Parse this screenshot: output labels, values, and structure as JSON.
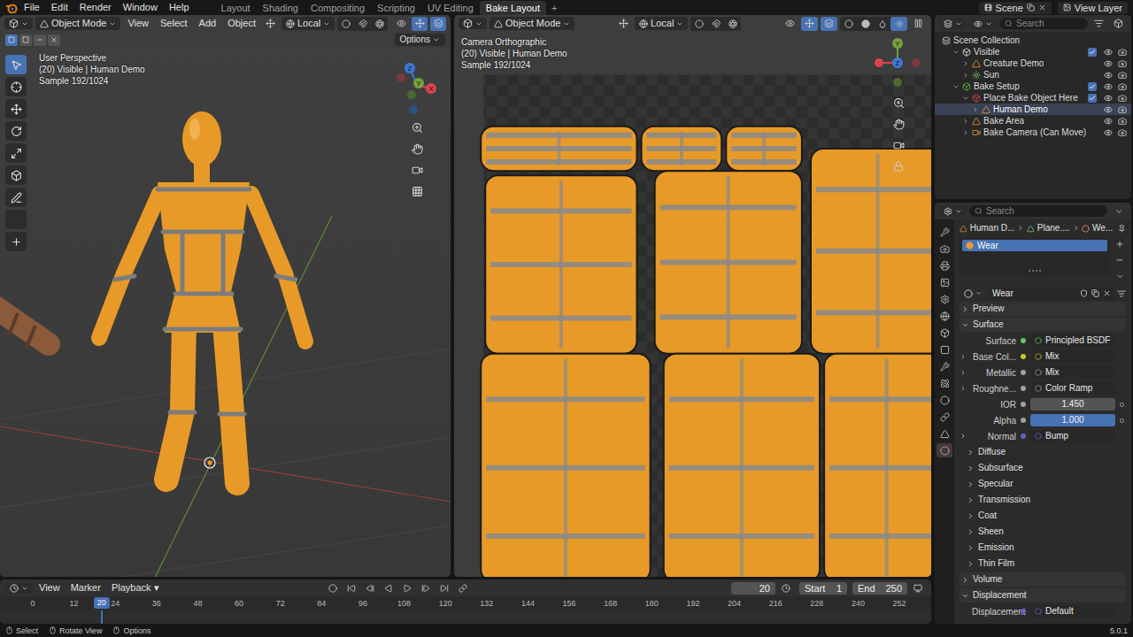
{
  "topbar": {
    "menus": [
      "File",
      "Edit",
      "Render",
      "Window",
      "Help"
    ],
    "workspaces": [
      {
        "label": "Layout",
        "selected": false
      },
      {
        "label": "Shading",
        "selected": false
      },
      {
        "label": "Compositing",
        "selected": false
      },
      {
        "label": "Scripting",
        "selected": false
      },
      {
        "label": "UV Editing",
        "selected": false
      },
      {
        "label": "Bake Layout",
        "selected": true
      }
    ],
    "add": "+",
    "scene": "Scene",
    "view_layer": "View Layer"
  },
  "viewport_left": {
    "mode": "Object Mode",
    "menus": [
      "View",
      "Select",
      "Add",
      "Object"
    ],
    "orientation": "Local",
    "options": "Options",
    "overlay": [
      "User Perspective",
      "(20) Visible | Human Demo",
      "Sample 192/1024"
    ],
    "gizmo": [
      {
        "label": "X",
        "color": "#e0424e"
      },
      {
        "label": "Y",
        "color": "#73a23a"
      },
      {
        "label": "Z",
        "color": "#3b79d6"
      }
    ]
  },
  "viewport_right": {
    "mode": "Object Mode",
    "orientation": "Local",
    "overlay": [
      "Camera Orthographic",
      "(20) Visible | Human Demo",
      "Sample 192/1024"
    ],
    "gizmo": [
      {
        "label": "Y",
        "color": "#73a23a"
      },
      {
        "label": "Z",
        "color": "#3b79d6"
      }
    ]
  },
  "outliner": {
    "search": {
      "placeholder": "Search"
    },
    "items": [
      {
        "label": "Scene Collection",
        "depth": 0,
        "kind": "scene",
        "selected": false
      },
      {
        "label": "Visible",
        "depth": 1,
        "kind": "collection",
        "color": "#e6e6e6",
        "expanded": true,
        "checked": true,
        "visible": true,
        "renderable": true,
        "selected": false
      },
      {
        "label": "Creature Demo",
        "depth": 2,
        "kind": "mesh",
        "expanded": false,
        "visible": true,
        "renderable": true,
        "selected": false
      },
      {
        "label": "Sun",
        "depth": 2,
        "kind": "light",
        "expanded": false,
        "visible": true,
        "renderable": true,
        "selected": false
      },
      {
        "label": "Bake Setup",
        "depth": 1,
        "kind": "collection",
        "color": "#5fb84a",
        "expanded": true,
        "checked": true,
        "visible": true,
        "renderable": true,
        "selected": false
      },
      {
        "label": "Place Bake Object Here",
        "depth": 2,
        "kind": "collection",
        "color": "#e04848",
        "expanded": true,
        "checked": true,
        "visible": true,
        "renderable": true,
        "selected": false
      },
      {
        "label": "Human Demo",
        "depth": 3,
        "kind": "mesh",
        "expanded": false,
        "visible": true,
        "renderable": true,
        "selected": true
      },
      {
        "label": "Bake Area",
        "depth": 2,
        "kind": "mesh",
        "expanded": false,
        "visible": true,
        "renderable": true,
        "selected": false
      },
      {
        "label": "Bake Camera (Can Move)",
        "depth": 2,
        "kind": "camera",
        "expanded": false,
        "visible": true,
        "renderable": true,
        "selected": false
      }
    ]
  },
  "properties": {
    "search": {
      "placeholder": "Search"
    },
    "tabs": [
      {
        "kind": "tool",
        "selected": false
      },
      {
        "kind": "render",
        "selected": false
      },
      {
        "kind": "output",
        "selected": false
      },
      {
        "kind": "view-layer",
        "selected": false
      },
      {
        "kind": "scene",
        "selected": false
      },
      {
        "kind": "world",
        "selected": false
      },
      {
        "kind": "collection",
        "selected": false
      },
      {
        "kind": "object",
        "selected": false
      },
      {
        "kind": "modifier",
        "selected": false
      },
      {
        "kind": "particles",
        "selected": false
      },
      {
        "kind": "physics",
        "selected": false
      },
      {
        "kind": "constraint",
        "selected": false
      },
      {
        "kind": "data",
        "selected": false
      },
      {
        "kind": "material",
        "selected": true
      }
    ],
    "breadcrumb": [
      "Human D...",
      "Plane....",
      "We..."
    ],
    "slots": [
      {
        "label": "Wear",
        "selected": true
      }
    ],
    "material": "Wear",
    "panels": [
      {
        "label": "Preview",
        "expanded": false,
        "rows": [],
        "subpanels": []
      },
      {
        "label": "Surface",
        "expanded": true,
        "rows": [
          {
            "label": "Surface",
            "value": "Principled BSDF",
            "kind": "shader",
            "color": "#63c763"
          },
          {
            "label": "Base Col...",
            "value": "Mix",
            "kind": "socket",
            "expanded": false,
            "color": "#c7c729"
          },
          {
            "label": "Metallic",
            "value": "Mix",
            "kind": "socket",
            "expanded": false,
            "color": "#a1a1a1"
          },
          {
            "label": "Roughne...",
            "value": "Color Ramp",
            "kind": "socket",
            "expanded": false,
            "color": "#a1a1a1"
          },
          {
            "label": "IOR",
            "value": "1.450",
            "kind": "number",
            "color": "#a1a1a1"
          },
          {
            "label": "Alpha",
            "value": "1.000",
            "kind": "slider",
            "level": 1,
            "color": "#a1a1a1"
          },
          {
            "label": "Normal",
            "value": "Bump",
            "kind": "socket",
            "expanded": false,
            "color": "#6363c7"
          }
        ],
        "subpanels": [
          {
            "label": "Diffuse",
            "expanded": false
          },
          {
            "label": "Subsurface",
            "expanded": false
          },
          {
            "label": "Specular",
            "expanded": false
          },
          {
            "label": "Transmission",
            "expanded": false
          },
          {
            "label": "Coat",
            "expanded": false
          },
          {
            "label": "Sheen",
            "expanded": false
          },
          {
            "label": "Emission",
            "expanded": false
          },
          {
            "label": "Thin Film",
            "expanded": false
          }
        ]
      },
      {
        "label": "Volume",
        "expanded": false,
        "rows": [],
        "subpanels": []
      },
      {
        "label": "Displacement",
        "expanded": true,
        "rows": [
          {
            "label": "Displacement",
            "value": "Default",
            "kind": "shader",
            "color": "#6363c7"
          }
        ],
        "subpanels": []
      }
    ]
  },
  "timeline": {
    "menus": [
      "View",
      "Marker",
      "Playback"
    ],
    "frame": "20",
    "start_label": "Start",
    "start": "1",
    "end_label": "End",
    "end": "250",
    "current": "20",
    "ticks": [
      "0",
      "12",
      "24",
      "36",
      "48",
      "60",
      "72",
      "84",
      "96",
      "108",
      "120",
      "132",
      "144",
      "156",
      "168",
      "180",
      "192",
      "204",
      "216",
      "228",
      "240",
      "252"
    ]
  },
  "status_bar": {
    "items": [
      "Select",
      "Rotate View",
      "Options"
    ],
    "version": "5.0.1"
  }
}
